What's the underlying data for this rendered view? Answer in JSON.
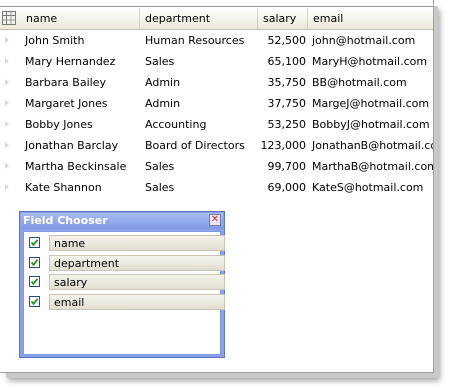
{
  "grid": {
    "columns": [
      "name",
      "department",
      "salary",
      "email"
    ],
    "rows": [
      [
        "John Smith",
        "Human Resources",
        "52,500",
        "john@hotmail.com"
      ],
      [
        "Mary Hernandez",
        "Sales",
        "65,100",
        "MaryH@hotmail.com"
      ],
      [
        "Barbara Bailey",
        "Admin",
        "35,750",
        "BB@hotmail.com"
      ],
      [
        "Margaret Jones",
        "Admin",
        "37,750",
        "MargeJ@hotmail.com"
      ],
      [
        "Bobby Jones",
        "Accounting",
        "53,250",
        "BobbyJ@hotmail.com"
      ],
      [
        "Jonathan Barclay",
        "Board of Directors",
        "123,000",
        "JonathanB@hotmail.com"
      ],
      [
        "Martha Beckinsale",
        "Sales",
        "99,700",
        "MarthaB@hotmail.com"
      ],
      [
        "Kate Shannon",
        "Sales",
        "69,000",
        "KateS@hotmail.com"
      ]
    ]
  },
  "field_chooser": {
    "title": "Field Chooser",
    "close_icon": "close-x",
    "fields": [
      {
        "label": "name",
        "checked": true
      },
      {
        "label": "department",
        "checked": true
      },
      {
        "label": "salary",
        "checked": true
      },
      {
        "label": "email",
        "checked": true
      }
    ]
  },
  "colors": {
    "chooser_bg": "#8aa3e8",
    "checkmark": "#1c9a1c"
  }
}
